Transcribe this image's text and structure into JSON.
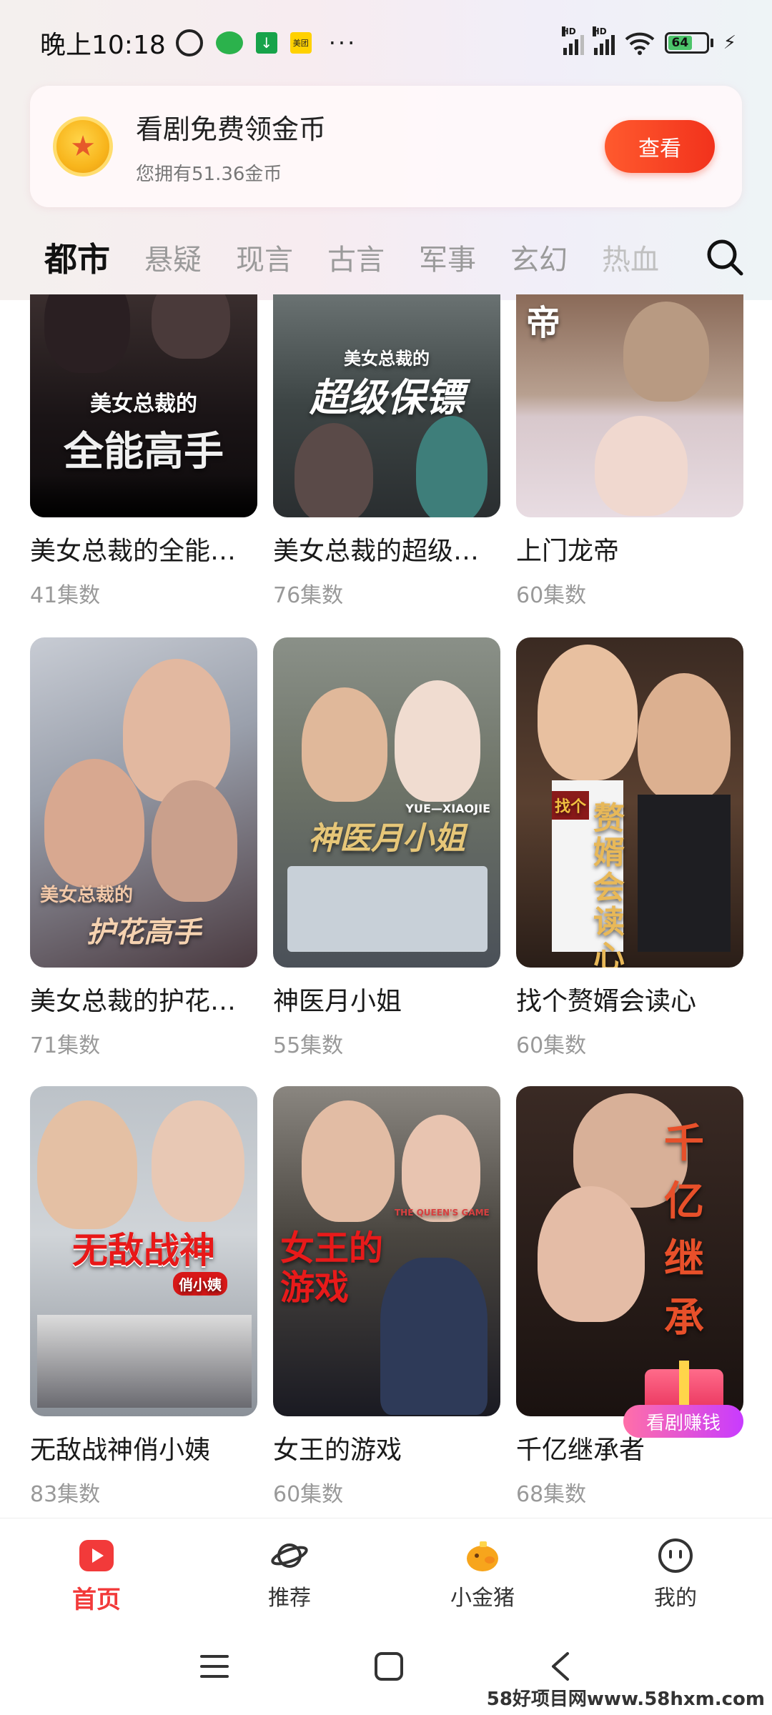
{
  "status_bar": {
    "time": "晚上10:18",
    "app_badge_meituan": "美团",
    "more": "···",
    "battery": "64",
    "hd1": "HD",
    "hd2": "HD"
  },
  "coin_banner": {
    "title": "看剧免费领金币",
    "subtitle": "您拥有51.36金币",
    "button": "查看"
  },
  "tabs": [
    {
      "label": "都市",
      "active": true
    },
    {
      "label": "悬疑"
    },
    {
      "label": "现言"
    },
    {
      "label": "古言"
    },
    {
      "label": "军事"
    },
    {
      "label": "玄幻"
    },
    {
      "label": "热血"
    }
  ],
  "dramas": [
    {
      "title": "美女总裁的全能…",
      "episodes": "41集数",
      "poster_text": "全能高手",
      "poster_sub": "美女总裁的"
    },
    {
      "title": "美女总裁的超级…",
      "episodes": "76集数",
      "poster_text": "超级保镖",
      "poster_sub": "美女总裁的"
    },
    {
      "title": "上门龙帝",
      "episodes": "60集数",
      "poster_text": "帝",
      "poster_sub": ""
    },
    {
      "title": "美女总裁的护花…",
      "episodes": "71集数",
      "poster_text": "护花高手",
      "poster_sub": "美女总裁的"
    },
    {
      "title": "神医月小姐",
      "episodes": "55集数",
      "poster_text": "神医月小姐",
      "poster_sub": "YUE—XIAOJIE"
    },
    {
      "title": "找个赘婿会读心",
      "episodes": "60集数",
      "poster_text": "赘婿会读心",
      "poster_sub": "找个"
    },
    {
      "title": "无敌战神俏小姨",
      "episodes": "83集数",
      "poster_text": "无敌战神",
      "poster_sub": "俏小姨"
    },
    {
      "title": "女王的游戏",
      "episodes": "60集数",
      "poster_text": "女王的游戏",
      "poster_sub": "THE QUEEN'S GAME"
    },
    {
      "title": "千亿继承者",
      "episodes": "68集数",
      "poster_text": "千亿继承",
      "poster_sub": ""
    }
  ],
  "reward_badge": "看剧赚钱",
  "bottom_nav": [
    {
      "label": "首页",
      "icon": "home-play-icon",
      "active": true
    },
    {
      "label": "推荐",
      "icon": "planet-icon"
    },
    {
      "label": "小金猪",
      "icon": "piggy-bank-icon"
    },
    {
      "label": "我的",
      "icon": "smiley-icon"
    }
  ],
  "watermark": "58好项目网www.58hxm.com",
  "colors": {
    "accent": "#f23a3a",
    "button": "#f2321c",
    "tab_underline": "#ffc8d0"
  }
}
